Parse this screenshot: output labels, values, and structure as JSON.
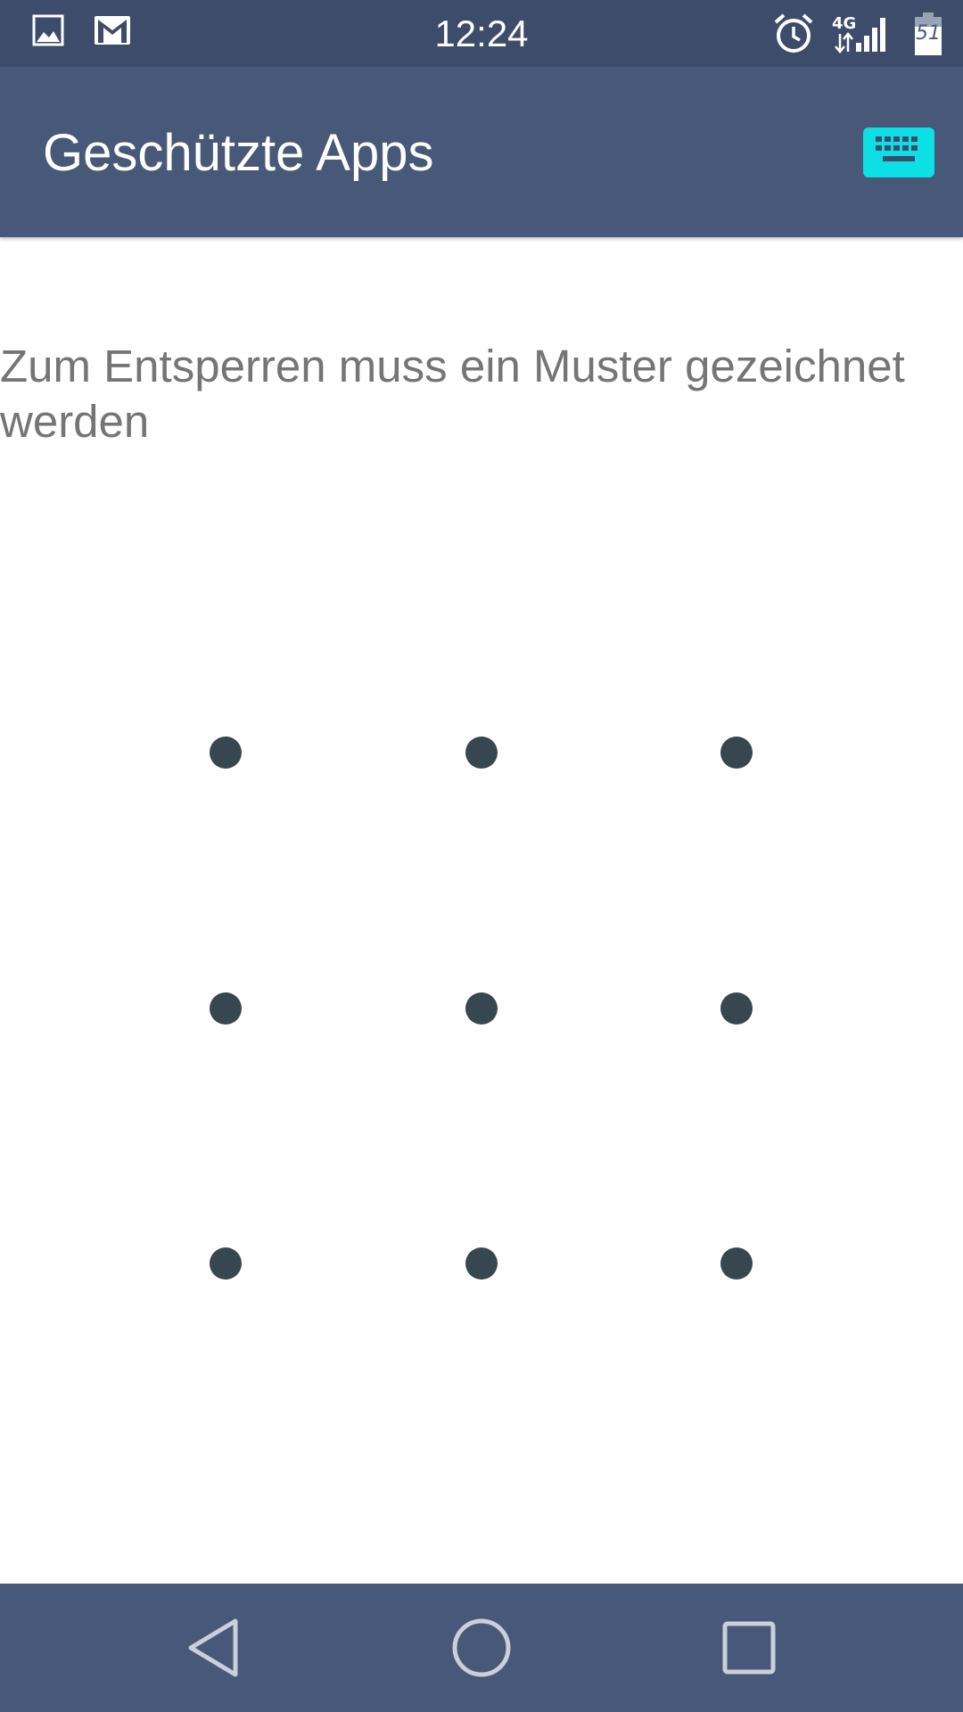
{
  "status_bar": {
    "time": "12:24",
    "network": "4G",
    "battery_level": "51",
    "icons": [
      "image-notification-icon",
      "gmail-notification-icon",
      "alarm-icon",
      "signal-4g-icon",
      "battery-icon"
    ]
  },
  "app_bar": {
    "title": "Geschützte Apps",
    "keyboard_icon": "keyboard-icon",
    "accent_color": "#0de0e4"
  },
  "content": {
    "instruction": "Zum Entsperren muss ein Muster gezeichnet werden",
    "pattern_dots": 9
  },
  "nav_bar": {
    "buttons": [
      "back-icon",
      "home-icon",
      "recents-icon"
    ]
  },
  "colors": {
    "status_bar": "#3e4c6b",
    "app_bar": "#475878",
    "dot": "#37474f",
    "instruction_text": "#757575"
  }
}
